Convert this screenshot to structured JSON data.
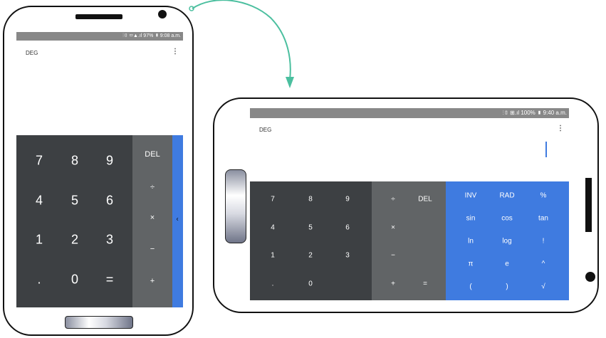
{
  "portrait": {
    "status_bar": "⫶▯ ▭▲.ıl 97% ▮ 9:08 a.m.",
    "mode": "DEG",
    "menu": "⋮",
    "digits": [
      "7",
      "8",
      "9",
      "4",
      "5",
      "6",
      "1",
      "2",
      "3",
      ".",
      "0",
      "="
    ],
    "ops": [
      "DEL",
      "÷",
      "×",
      "−",
      "+"
    ],
    "panel_handle": "‹"
  },
  "landscape": {
    "status_bar": "⫶▯ ⊞.ıl 100% ▮ 9:40 a.m.",
    "mode": "DEG",
    "menu": "⋮",
    "digits": [
      "7",
      "8",
      "9",
      "4",
      "5",
      "6",
      "1",
      "2",
      "3",
      ".",
      "0"
    ],
    "ops": [
      "÷",
      "DEL",
      "×",
      "−",
      "+",
      "="
    ],
    "advanced": [
      "INV",
      "RAD",
      "%",
      "sin",
      "cos",
      "tan",
      "ln",
      "log",
      "!",
      "π",
      "e",
      "^",
      "(",
      ")",
      "√"
    ]
  },
  "colors": {
    "accent": "#3f7be0",
    "arrow": "#4bbf9f",
    "keypad_dark": "#3d4043",
    "keypad_ops": "#616466"
  }
}
